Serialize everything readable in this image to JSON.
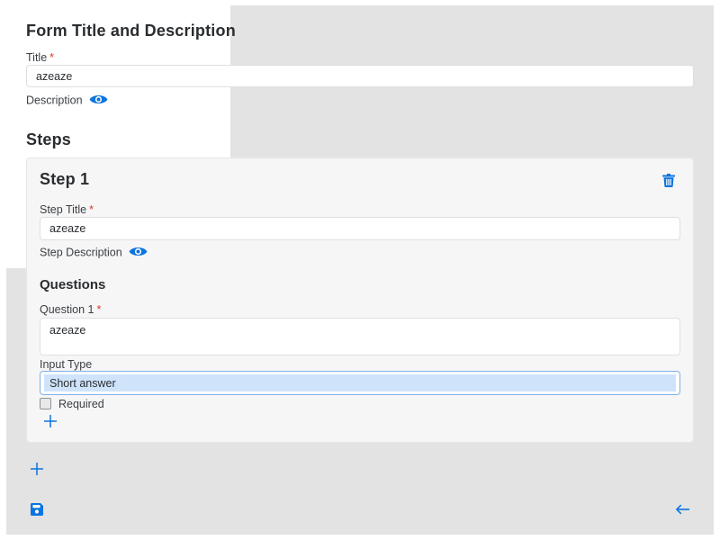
{
  "colors": {
    "accent": "#0b74de",
    "required": "#e0352b",
    "background": "#e3e3e3"
  },
  "form": {
    "heading": "Form Title and Description",
    "title_label": "Title",
    "required_mark": "*",
    "title_value": "azeaze",
    "description_label": "Description",
    "description_toggle_icon": "eye-icon"
  },
  "steps": {
    "heading": "Steps",
    "add_step_icon": "plus-icon",
    "items": [
      {
        "heading": "Step 1",
        "delete_icon": "trash-icon",
        "title_label": "Step Title",
        "title_value": "azeaze",
        "description_label": "Step Description",
        "questions_heading": "Questions",
        "question_label": "Question 1",
        "question_value": "azeaze",
        "input_type_label": "Input Type",
        "input_type_value": "Short answer",
        "required_label": "Required",
        "required_checked": false,
        "add_question_icon": "plus-icon"
      }
    ]
  },
  "footer": {
    "save_icon": "save-icon",
    "back_icon": "arrow-left-icon"
  }
}
